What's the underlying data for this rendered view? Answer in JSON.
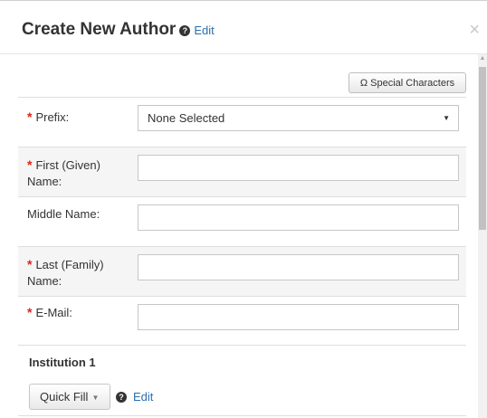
{
  "header": {
    "title": "Create New Author",
    "help_icon": "?",
    "edit_label": "Edit",
    "close_label": "×"
  },
  "toolbar": {
    "special_characters": "Ω Special Characters"
  },
  "fields": {
    "prefix": {
      "label": "Prefix:",
      "required_mark": "*",
      "selected": "None Selected",
      "caret": "▼"
    },
    "first_name": {
      "label_line1": "First (Given)",
      "label_line2": "Name:",
      "required_mark": "*",
      "value": ""
    },
    "middle_name": {
      "label": "Middle Name:",
      "value": ""
    },
    "last_name": {
      "label_line1": "Last (Family)",
      "label_line2": "Name:",
      "required_mark": "*",
      "value": ""
    },
    "email": {
      "label": "E-Mail:",
      "required_mark": "*",
      "value": ""
    }
  },
  "institution": {
    "title": "Institution 1",
    "quick_fill_label": "Quick Fill",
    "quick_fill_caret": "▼",
    "help_icon": "?",
    "edit_label": "Edit"
  },
  "scrollbar": {
    "up_arrow": "▲"
  }
}
